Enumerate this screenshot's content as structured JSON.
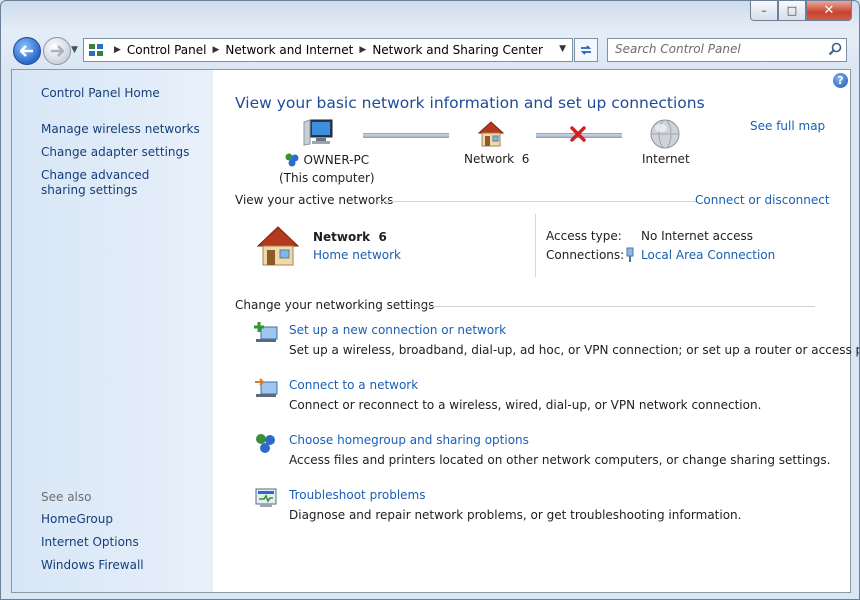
{
  "window": {
    "minimize_glyph": "–",
    "maximize_glyph": "□",
    "close_glyph": "✕"
  },
  "nav": {
    "breadcrumbs": [
      "Control Panel",
      "Network and Internet",
      "Network and Sharing Center"
    ],
    "search_placeholder": "Search Control Panel"
  },
  "sidebar": {
    "home": "Control Panel Home",
    "tasks": [
      "Manage wireless networks",
      "Change adapter settings",
      "Change advanced sharing settings"
    ],
    "see_also_label": "See also",
    "see_also": [
      "HomeGroup",
      "Internet Options",
      "Windows Firewall"
    ]
  },
  "main": {
    "help_glyph": "?",
    "title": "View your basic network information and set up connections",
    "see_full_map": "See full map",
    "map": {
      "computer_name": "OWNER-PC",
      "computer_sub": "(This computer)",
      "network_name": "Network  6",
      "internet": "Internet"
    },
    "active_networks_label": "View your active networks",
    "connect_or_disconnect": "Connect or disconnect",
    "active": {
      "network_name": "Network  6",
      "network_type": "Home network",
      "access_type_label": "Access type:",
      "access_type_value": "No Internet access",
      "connections_label": "Connections:",
      "connections_value": "Local Area Connection"
    },
    "change_settings_label": "Change your networking settings",
    "tasks": [
      {
        "title": "Set up a new connection or network",
        "desc": "Set up a wireless, broadband, dial-up, ad hoc, or VPN connection; or set up a router or access point."
      },
      {
        "title": "Connect to a network",
        "desc": "Connect or reconnect to a wireless, wired, dial-up, or VPN network connection."
      },
      {
        "title": "Choose homegroup and sharing options",
        "desc": "Access files and printers located on other network computers, or change sharing settings."
      },
      {
        "title": "Troubleshoot problems",
        "desc": "Diagnose and repair network problems, or get troubleshooting information."
      }
    ]
  },
  "colors": {
    "link": "#1a5fb4",
    "title": "#1e4b9a",
    "sidebar_link": "#163f79",
    "error_x": "#d12020"
  },
  "icons": {
    "back": "back-arrow-icon",
    "forward": "forward-arrow-icon",
    "refresh": "refresh-icon",
    "search": "search-icon",
    "computer": "computer-icon",
    "house": "home-network-icon",
    "globe": "globe-icon",
    "disconnected": "red-x-icon",
    "lan": "network-cable-icon"
  }
}
